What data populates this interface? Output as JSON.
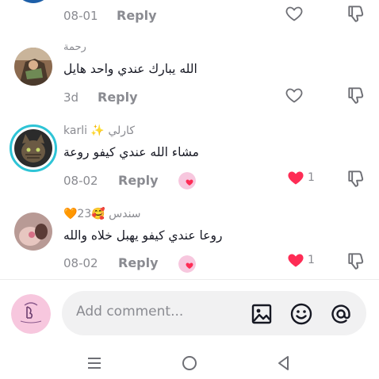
{
  "comments": [
    {
      "username": "",
      "text": "",
      "date": "08-01",
      "reply_label": "Reply",
      "likes": "",
      "liked": false
    },
    {
      "username": "رحمة",
      "text": "الله يبارك عندي واحد هايل",
      "date": "3d",
      "reply_label": "Reply",
      "likes": "",
      "liked": false
    },
    {
      "username": "karli ✨ كارلي",
      "text": "مشاء الله عندي كيفو روعة",
      "date": "08-02",
      "reply_label": "Reply",
      "likes": "1",
      "liked": true
    },
    {
      "username": "🧡23🥰 سندس",
      "text": "روعا عندي كيفو يهبل خلاه والله",
      "date": "08-02",
      "reply_label": "Reply",
      "likes": "1",
      "liked": true
    }
  ],
  "input": {
    "placeholder": "Add comment..."
  },
  "icons": {
    "like": "heart-outline-icon",
    "liked": "heart-filled-icon",
    "dislike": "thumbs-down-icon",
    "image": "image-icon",
    "emoji": "smiley-icon",
    "mention": "at-icon",
    "nav_menu": "menu-icon",
    "nav_home": "home-circle-icon",
    "nav_back": "back-triangle-icon"
  },
  "colors": {
    "liked_red": "#fe2c55",
    "muted_gray": "#8a8b91",
    "text_dark": "#161823",
    "input_bg": "#f1f1f2",
    "avatar_ring": "#2ec4d6",
    "creator_pink": "#f7c7de"
  }
}
